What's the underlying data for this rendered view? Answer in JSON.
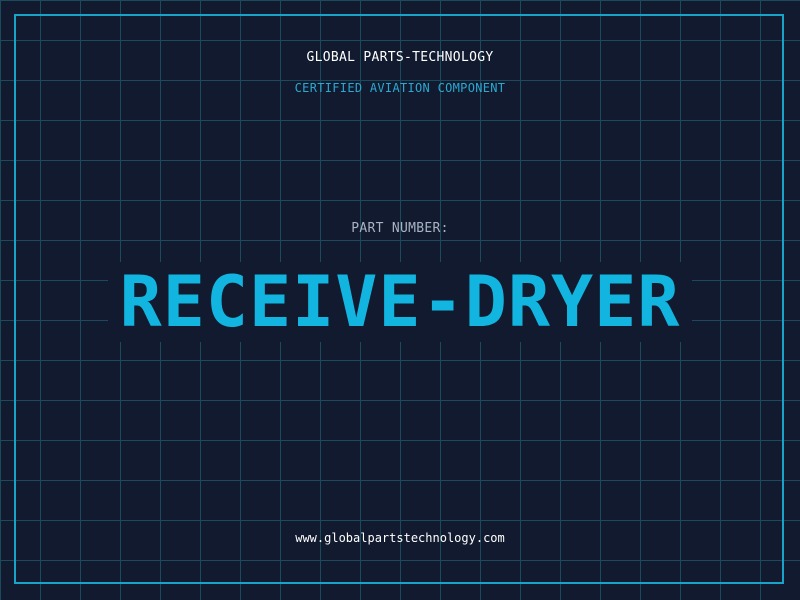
{
  "header": {
    "company": "GLOBAL PARTS-TECHNOLOGY",
    "subtitle": "CERTIFIED AVIATION COMPONENT"
  },
  "main": {
    "part_number_label": "PART NUMBER:",
    "part_number": "RECEIVE-DRYER"
  },
  "footer": {
    "website": "www.globalpartstechnology.com"
  },
  "colors": {
    "background": "#111a2e",
    "grid": "#1b4a5c",
    "accent": "#12b5e0",
    "border": "#1aa3c9"
  }
}
